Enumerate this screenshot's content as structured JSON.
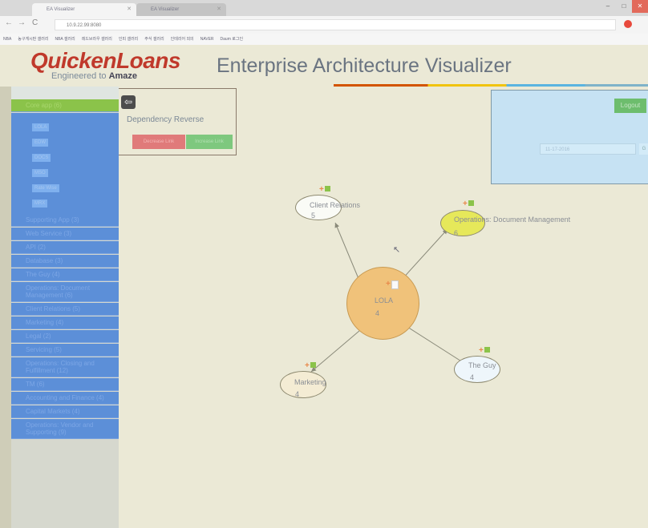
{
  "browser": {
    "tabs": [
      {
        "label": "EA Visualizer",
        "active": true
      },
      {
        "label": "EA Visualizer",
        "active": false
      }
    ],
    "url": "10.9.22.99:8080",
    "bookmarks": [
      "NBA",
      "농구게시판 갤러리",
      "NBA 갤러리",
      "레드브라우 갤러리",
      "인피 갤러리",
      "주식 갤러리",
      "인테리어 외의",
      "NAVER",
      "Daum 로그인"
    ]
  },
  "header": {
    "logo": "QuickenLoans",
    "tagline_prefix": "Engineered to ",
    "tagline_bold": "Amaze",
    "title": "Enterprise Architecture Visualizer"
  },
  "sidebar": {
    "core_app": {
      "label": "Core app (6)",
      "apps": [
        "LOLA",
        "EDW",
        "DOCS",
        "MSO",
        "Rate Wise",
        "MRX"
      ]
    },
    "categories": [
      "Supporting App (3)",
      "Web Service (3)",
      "API (2)",
      "Database (3)",
      "The Guy (4)",
      "Operations: Document Management (6)",
      "Client Relations (5)",
      "Marketing (4)",
      "Legal (2)",
      "Servicing (5)",
      "Operations: Closing and Fulfillment (12)",
      "TM (6)",
      "Accounting and Finance (4)",
      "Capital Markets (4)",
      "Operations: Vendor and Supporting (9)"
    ]
  },
  "controls": {
    "back_icon": "back-arrow-icon",
    "mode_label": "Dependency Reverse",
    "decrease_label": "Decrease Link",
    "increase_label": "Increase Link"
  },
  "user_panel": {
    "logout_label": "Logout",
    "date_value": "11-17-2016",
    "date_button": "G"
  },
  "graph": {
    "center": {
      "label": "LOLA",
      "count": "4"
    },
    "nodes": [
      {
        "label": "Client Relations",
        "count": "5"
      },
      {
        "label": "Operations: Document Management",
        "count": "6"
      },
      {
        "label": "Marketing",
        "count": "4"
      },
      {
        "label": "The Guy",
        "count": "4"
      }
    ]
  },
  "colors": {
    "accent_red": "#c0392b",
    "sidebar_blue": "#5c8fd8",
    "active_green": "#8bc34a",
    "center_orange": "#f0c27a",
    "doc_yellow": "#e6e85a"
  }
}
